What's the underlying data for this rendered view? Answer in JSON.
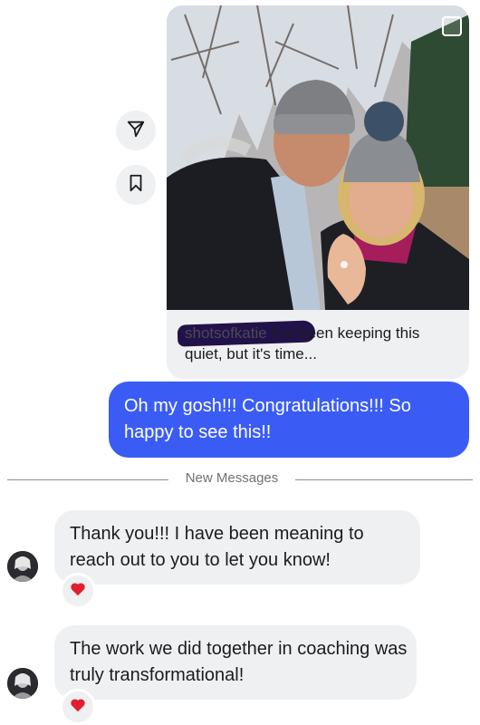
{
  "post": {
    "image_alt": "Couple selfie in winter hats, woman showing engagement ring",
    "caption_username": "shotsofkatie",
    "caption_text": "I've been keeping this quiet, but it's time..."
  },
  "side_actions": {
    "share_icon": "send-icon",
    "save_icon": "bookmark-icon"
  },
  "outgoing": {
    "text": "Oh my gosh!!! Congratulations!!! So happy to see this!!"
  },
  "divider": {
    "label": "New Messages"
  },
  "incoming": [
    {
      "text": "Thank you!!! I have been meaning to reach out to you to let you know!",
      "reaction": "❤️"
    },
    {
      "text": "The work we did together in coaching was truly transformational!",
      "reaction": "❤️"
    }
  ],
  "colors": {
    "outgoing_bubble": "#3a5cf5",
    "incoming_bubble": "#eff0f2",
    "reaction_heart": "#e0202e"
  }
}
